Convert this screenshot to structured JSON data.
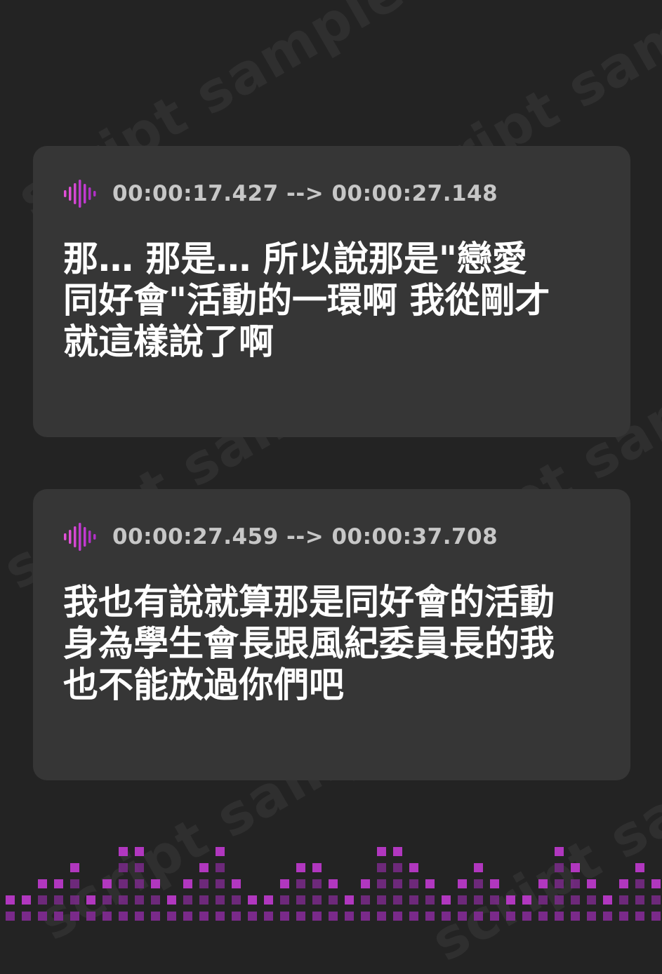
{
  "watermark": {
    "text": "script sample"
  },
  "cues": [
    {
      "timestamp": "00:00:17.427 --> 00:00:27.148",
      "lines": [
        "那… 那是… 所以說那是\"戀愛",
        "同好會\"活動的一環啊 我從剛才",
        "就這樣說了啊"
      ]
    },
    {
      "timestamp": "00:00:27.459 --> 00:00:37.708",
      "lines": [
        "我也有說就算那是同好會的活動",
        "身為學生會長跟風紀委員長的我",
        "也不能放過你們吧"
      ]
    }
  ],
  "colors": {
    "background": "#232323",
    "card": "#363636",
    "accent_magenta": "#c13ad0",
    "accent_purple": "#7a2a8a",
    "timestamp": "#c7c7c7",
    "caption": "#ffffff"
  },
  "icons": {
    "audio": "sound-wave-icon"
  }
}
